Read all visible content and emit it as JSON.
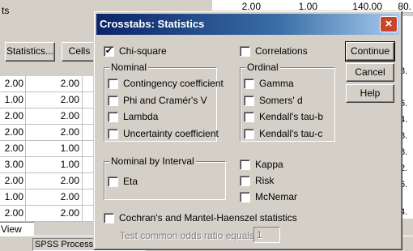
{
  "background": {
    "title_fragment": "ts",
    "statistics_button": "Statistics...",
    "cells_button": "Cells",
    "top_row": [
      "2.00",
      "1.00",
      "140.00",
      "80."
    ],
    "grid_rows": [
      {
        "a": "2.00",
        "b": "2.00"
      },
      {
        "a": "1.00",
        "b": "2.00"
      },
      {
        "a": "2.00",
        "b": "2.00"
      },
      {
        "a": "2.00",
        "b": "2.00"
      },
      {
        "a": "2.00",
        "b": "1.00"
      },
      {
        "a": "3.00",
        "b": "1.00"
      },
      {
        "a": "2.00",
        "b": "2.00"
      },
      {
        "a": "1.00",
        "b": "2.00"
      },
      {
        "a": "2.00",
        "b": "2.00"
      }
    ],
    "right_strip_values": [
      "0.",
      "",
      "",
      "8.",
      "6.",
      "4.",
      "8.",
      "8.",
      "2.",
      "6.",
      "",
      "4."
    ],
    "tab_label": "View",
    "status_text": "SPSS Processor"
  },
  "dialog": {
    "title": "Crosstabs: Statistics",
    "close_symbol": "×",
    "chi_square": {
      "label": "Chi-square",
      "checked": true
    },
    "correlations": {
      "label": "Correlations",
      "checked": false
    },
    "nominal": {
      "title": "Nominal",
      "items": [
        "Contingency coefficient",
        "Phi and Cramér's V",
        "Lambda",
        "Uncertainty coefficient"
      ]
    },
    "ordinal": {
      "title": "Ordinal",
      "items": [
        "Gamma",
        "Somers' d",
        "Kendall's tau-b",
        "Kendall's tau-c"
      ]
    },
    "nominal_by_interval": {
      "title": "Nominal by Interval",
      "items": [
        "Eta"
      ]
    },
    "other": [
      "Kappa",
      "Risk",
      "McNemar"
    ],
    "cmh": "Cochran's and Mantel-Haenszel statistics",
    "odds_label": "Test common odds ratio equals:",
    "odds_value": "1",
    "buttons": {
      "continue": "Continue",
      "cancel": "Cancel",
      "help": "Help"
    }
  }
}
